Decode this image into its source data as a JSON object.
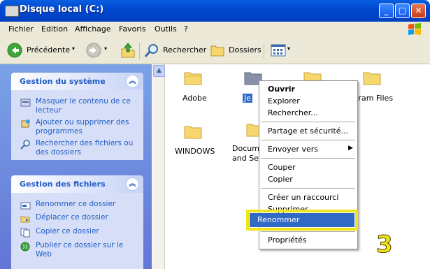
{
  "window": {
    "title": "Disque local (C:)"
  },
  "caption_buttons": {
    "minimize": "_",
    "maximize": "□",
    "close": "✕"
  },
  "menu": [
    "Fichier",
    "Edition",
    "Affichage",
    "Favoris",
    "Outils",
    "?"
  ],
  "toolbar": {
    "back_label": "Précédente",
    "search_label": "Rechercher",
    "folders_label": "Dossiers"
  },
  "left_panels": {
    "system": {
      "title": "Gestion du système",
      "tasks": [
        "Masquer le contenu de ce lecteur",
        "Ajouter ou supprimer des programmes",
        "Rechercher des fichiers ou des dossiers"
      ]
    },
    "files": {
      "title": "Gestion des fichiers",
      "tasks": [
        "Renommer ce dossier",
        "Déplacer ce dossier",
        "Copier ce dossier",
        "Publier ce dossier sur le Web"
      ]
    }
  },
  "folders": [
    {
      "name": "Adobe"
    },
    {
      "name": "Je"
    },
    {
      "name": "Program Files"
    },
    {
      "name": "WINDOWS"
    },
    {
      "name": "Documents and Settings"
    }
  ],
  "context_menu": {
    "items": [
      "Ouvrir",
      "Explorer",
      "Rechercher...",
      "Partage et sécurité...",
      "Envoyer vers",
      "Couper",
      "Copier",
      "Créer un raccourci",
      "Supprimer",
      "Renommer",
      "Propriétés"
    ]
  },
  "step_number": "3",
  "colors": {
    "titlebar": "#0054e3",
    "panel_text": "#215dc6",
    "highlight": "#316ac5",
    "callout": "#f0e41a"
  }
}
